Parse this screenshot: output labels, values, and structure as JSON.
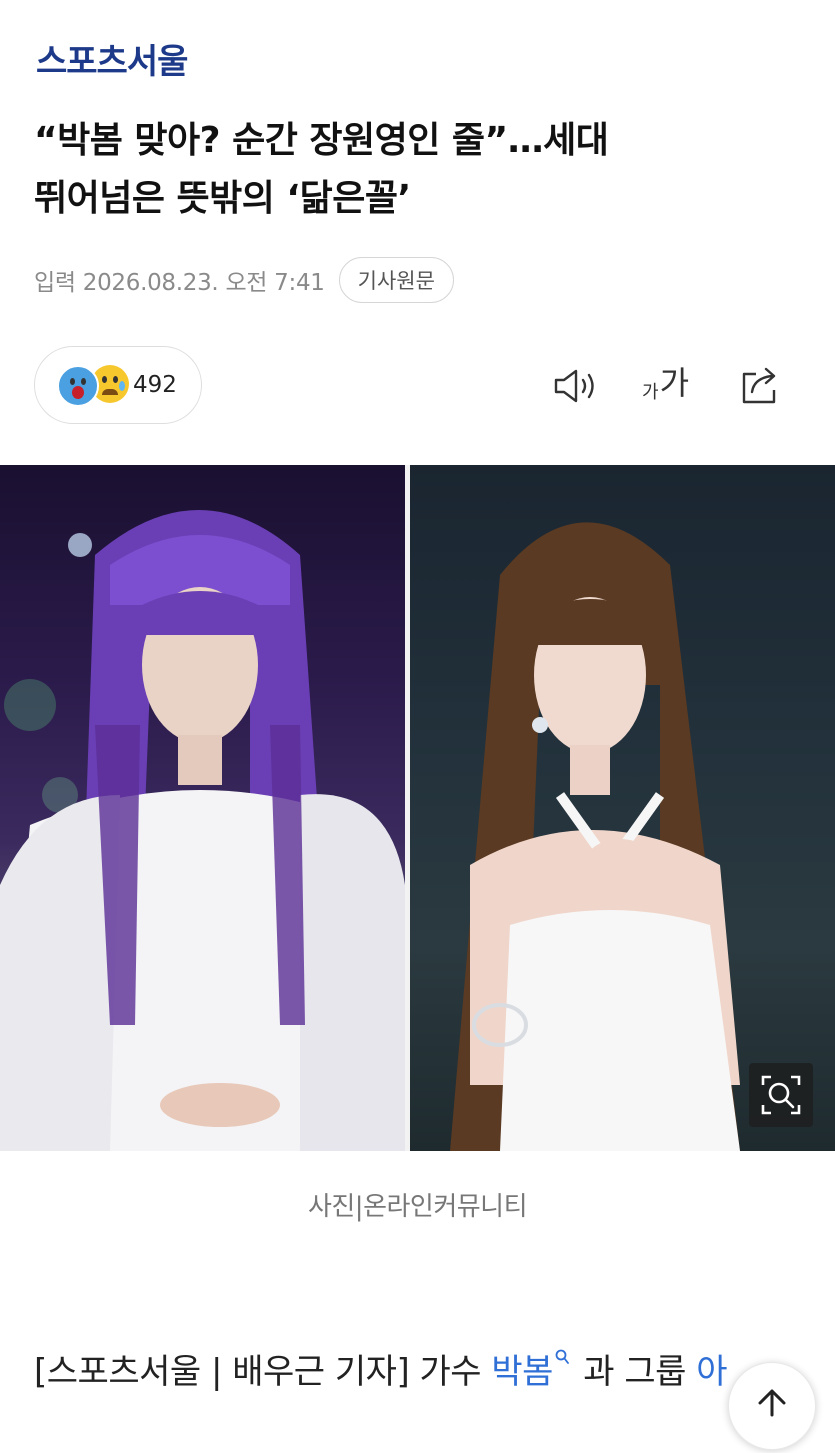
{
  "publisher": {
    "logo_text": "스포츠서울"
  },
  "article": {
    "headline_line1": "“박봄 맞아? 순간 장원영인 줄”…세대",
    "headline_line2": "뛰어넘은 뜻밖의 ‘닮은꼴’",
    "date": "입력 2026.08.23. 오전 7:41",
    "original_button": "기사원문"
  },
  "reactions": {
    "count": "492"
  },
  "toolbar": {
    "font_small": "가",
    "font_big": "가"
  },
  "image": {
    "caption": "사진|온라인커뮤니티"
  },
  "body": {
    "prefix": "[스포츠서울 | 배우근 기자] 가수 ",
    "link1": "박봄",
    "middle": " 과 그룹 ",
    "link2": "아"
  },
  "icons": {
    "speaker": "speaker-icon",
    "font_size": "font-size-icon",
    "share": "share-icon",
    "zoom": "zoom-icon",
    "search_small": "search-icon",
    "scroll_top": "arrow-up-icon"
  },
  "colors": {
    "logo": "#1d3a8a",
    "link": "#2f6fd6"
  }
}
